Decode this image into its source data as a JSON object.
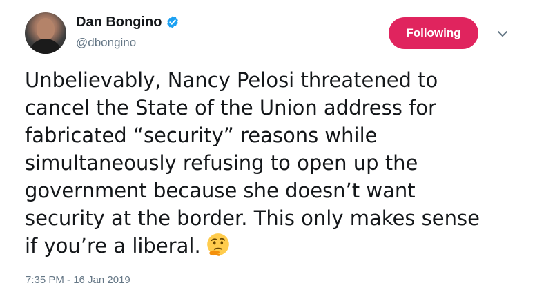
{
  "author": {
    "display_name": "Dan Bongino",
    "handle": "@dbongino",
    "verified_icon": "verified-badge-icon",
    "avatar_icon": "avatar"
  },
  "actions": {
    "follow_label": "Following",
    "menu_icon": "chevron-down-icon"
  },
  "tweet": {
    "lines": [
      "Unbelievably, Nancy Pelosi threatened to",
      "cancel the State of the Union address for",
      "fabricated “security” reasons while",
      "simultaneously refusing to open up the",
      "government because she doesn’t want",
      "security at the border. This only makes sense",
      "if you’re a liberal."
    ],
    "emoji_icon": "thinking-face-icon",
    "timestamp": "7:35 PM - 16 Jan 2019"
  },
  "colors": {
    "follow_button": "#e0245e",
    "verified": "#1da1f2",
    "secondary_text": "#657786",
    "primary_text": "#14171a"
  }
}
